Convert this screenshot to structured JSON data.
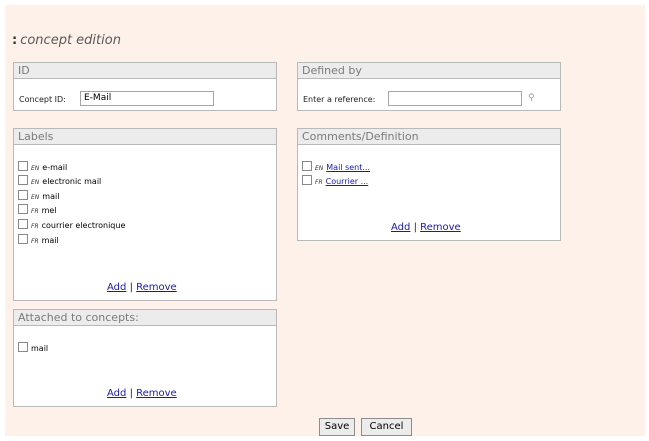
{
  "page": {
    "title_prefix": ":",
    "title": "concept edition"
  },
  "id_panel": {
    "header": "ID",
    "concept_id_label": "Concept ID:",
    "concept_id_value": "E-Mail"
  },
  "defined_by_panel": {
    "header": "Defined by",
    "reference_label": "Enter a reference:",
    "reference_value": "",
    "search_icon": "search-icon"
  },
  "labels_panel": {
    "header": "Labels",
    "items": [
      {
        "lang": "EN",
        "text": "e-mail"
      },
      {
        "lang": "EN",
        "text": "electronic mail"
      },
      {
        "lang": "EN",
        "text": "mail"
      },
      {
        "lang": "FR",
        "text": "mel"
      },
      {
        "lang": "FR",
        "text": "courrier electronique"
      },
      {
        "lang": "FR",
        "text": "mail"
      }
    ],
    "add": "Add",
    "separator": "|",
    "remove": "Remove"
  },
  "comments_panel": {
    "header": "Comments/Definition",
    "items": [
      {
        "lang": "EN",
        "text": "Mail sent..."
      },
      {
        "lang": "FR",
        "text": "Courrier ..."
      }
    ],
    "add": "Add",
    "separator": "|",
    "remove": "Remove"
  },
  "attached_panel": {
    "header": "Attached to concepts:",
    "items": [
      {
        "text": "mail"
      }
    ],
    "add": "Add",
    "separator": "|",
    "remove": "Remove"
  },
  "footer": {
    "save": "Save",
    "cancel": "Cancel"
  },
  "colors": {
    "page_background": "#fdf1ea",
    "panel_header": "#ececec",
    "link": "#1a1aaa"
  }
}
